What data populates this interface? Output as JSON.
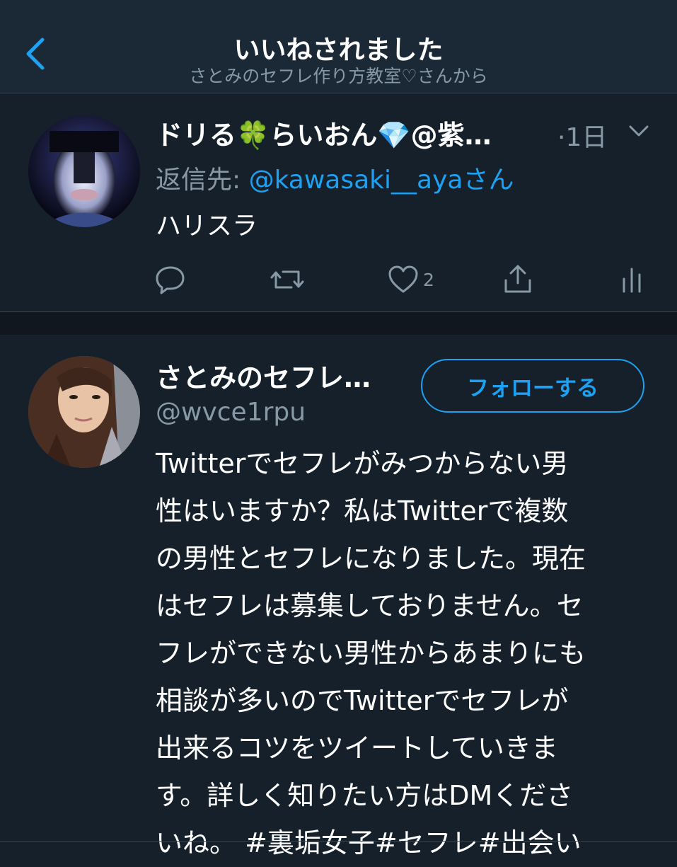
{
  "header": {
    "title": "いいねされました",
    "subtitle": "さとみのセフレ作り方教室♡さんから"
  },
  "tweet1": {
    "display_name": "ドリる🍀らいおん💎@紫…",
    "time": "·1日",
    "reply_prefix": "返信先: ",
    "reply_mention": "@kawasaki__aya",
    "reply_suffix": "さん",
    "text": "ハリスラ",
    "like_count": "2"
  },
  "tweet2": {
    "display_name": "さとみのセフレ…",
    "handle": "@wvce1rpu",
    "follow_label": "フォローする",
    "bio_lines": [
      "Twitterでセフレがみつからない男",
      "性はいますか？私はTwitterで複数",
      "の男性とセフレになりました。現在",
      "はセフレは募集しておりません。セ",
      "フレができない男性からあまりにも",
      "相談が多いのでTwitterでセフレが",
      "出来るコツをツイートしていきま",
      "す。詳しく知りたい方はDMくださ",
      "いね。 #裏垢女子#セフレ#出会い"
    ]
  },
  "colors": {
    "background": "#15202b",
    "header": "#1b2836",
    "accent": "#1da1f2",
    "muted": "#8899a6"
  },
  "icons": [
    "back-chevron-icon",
    "chevron-down-icon",
    "reply-icon",
    "retweet-icon",
    "like-icon",
    "share-icon",
    "analytics-icon"
  ]
}
